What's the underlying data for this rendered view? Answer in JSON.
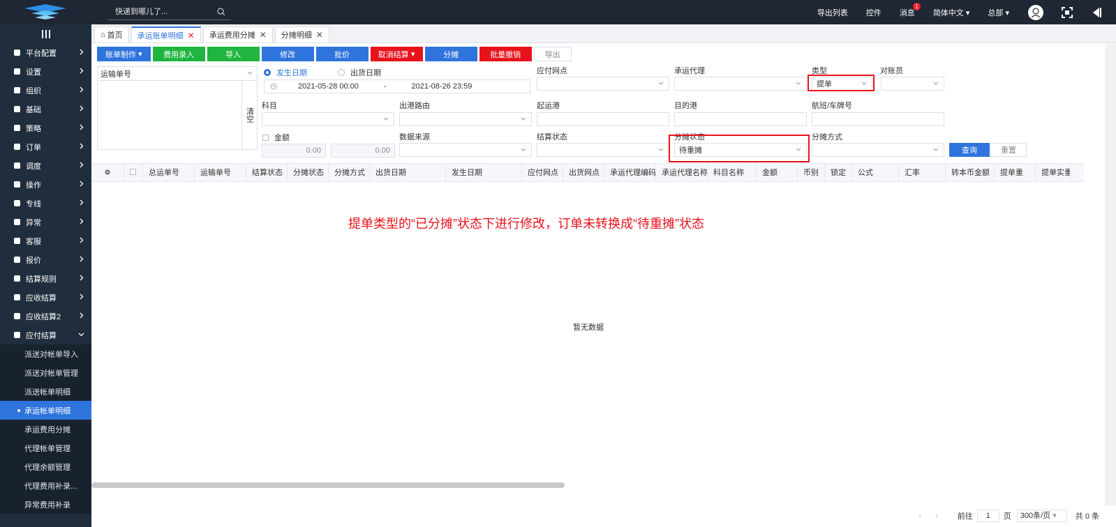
{
  "topbar": {
    "search_placeholder": "快递到哪儿了...",
    "items": {
      "export_list": "导出列表",
      "controls": "控件",
      "messages": "消息",
      "message_count": "1",
      "language": "简体中文",
      "branch": "总部"
    }
  },
  "sidebar": {
    "items": [
      "平台配置",
      "设置",
      "组织",
      "基础",
      "策略",
      "订单",
      "调度",
      "操作",
      "专线",
      "异常",
      "客服",
      "报价",
      "结算规则",
      "应收结算",
      "应收结算2",
      "应付结算"
    ],
    "sub_items": [
      "派送对帐单导入",
      "派送对帐单管理",
      "派送帐单明细",
      "承运帐单明细",
      "承运费用分摊",
      "代理帐单管理",
      "代理余额管理",
      "代理费用补录...",
      "异常费用补录"
    ]
  },
  "tabs": {
    "home": "首页",
    "t1": "承运账单明细",
    "t2": "承运费用分摊",
    "t3": "分摊明细"
  },
  "toolbar": {
    "billing": "账单制作",
    "fee_entry": "费用录入",
    "import": "导入",
    "modify": "修改",
    "approve": "批价",
    "cancel_settle": "取消结算",
    "allocate": "分摊",
    "batch_revoke": "批量撤销",
    "export": "导出"
  },
  "filters": {
    "tracking_no_select": "运输单号",
    "clear": "清空",
    "date_occur": "发生日期",
    "date_ship": "出货日期",
    "date_start": "2021-05-28 00:00",
    "date_sep": "-",
    "date_end": "2021-08-26 23:59",
    "payable_point": "应付网点",
    "carrier_agent": "承运代理",
    "type": "类型",
    "type_value": "提单",
    "reconciler": "对账员",
    "subject": "科目",
    "outbound_route": "出港路由",
    "origin_port": "起运港",
    "dest_port": "目的港",
    "flight_plate": "航班/车牌号",
    "amount": "金额",
    "amount_min": "0.00",
    "amount_max": "0.00",
    "data_source": "数据来源",
    "settle_status": "结算状态",
    "alloc_status": "分摊状态",
    "alloc_status_value": "待重摊",
    "alloc_method": "分摊方式",
    "query": "查询",
    "reset": "重置"
  },
  "grid": {
    "columns": [
      "总运单号",
      "运输单号",
      "结算状态",
      "分摊状态",
      "分摊方式",
      "出货日期",
      "发生日期",
      "应付网点",
      "出货网点",
      "承运代理编码",
      "承运代理名称",
      "科目名称",
      "金额",
      "币别",
      "锁定",
      "公式",
      "汇率",
      "转本币金额",
      "提单重",
      "提单实重"
    ],
    "empty_text": "暂无数据"
  },
  "annotation": "提单类型的“已分摊”状态下进行修改，订单未转换成“待重摊”状态",
  "pagination": {
    "prev_label": "前往",
    "page": "1",
    "page_unit": "页",
    "page_size": "300条/页",
    "total": "共 0 条"
  }
}
